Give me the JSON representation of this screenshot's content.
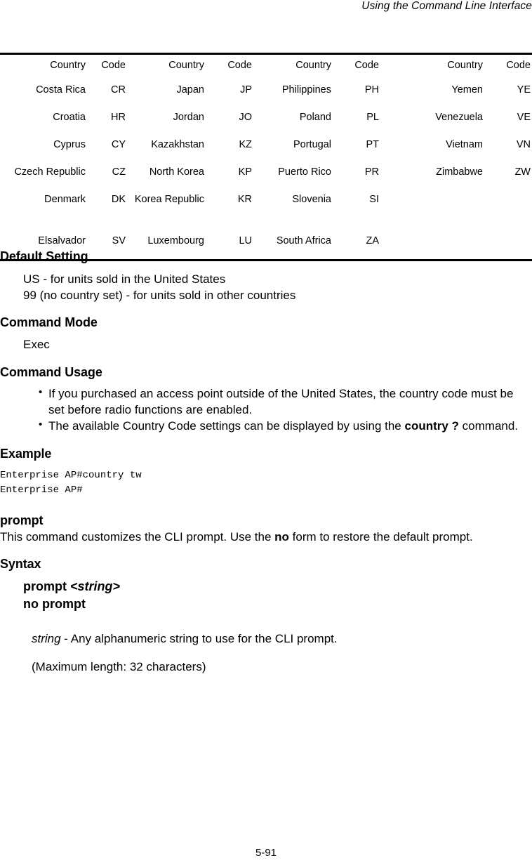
{
  "header": {
    "running_title": "Using the Command Line Interface"
  },
  "country_table": {
    "columns": [
      "Country",
      "Code",
      "Country",
      "Code",
      "Country",
      "Code",
      "Country",
      "Code"
    ],
    "rows": [
      [
        "Costa Rica",
        "CR",
        "Japan",
        "JP",
        "Philippines",
        "PH",
        "Yemen",
        "YE"
      ],
      [
        "Croatia",
        "HR",
        "Jordan",
        "JO",
        "Poland",
        "PL",
        "Venezuela",
        "VE"
      ],
      [
        "Cyprus",
        "CY",
        "Kazakhstan",
        "KZ",
        "Portugal",
        "PT",
        "Vietnam",
        "VN"
      ],
      [
        "Czech Republic",
        "CZ",
        "North Korea",
        "KP",
        "Puerto Rico",
        "PR",
        "Zimbabwe",
        "ZW"
      ],
      [
        "Denmark",
        "DK",
        "Korea Republic",
        "KR",
        "Slovenia",
        "SI",
        "",
        ""
      ],
      [
        "Elsalvador",
        "SV",
        "Luxembourg",
        "LU",
        "South Africa",
        "ZA",
        "",
        ""
      ]
    ]
  },
  "sections": {
    "default_setting": {
      "heading": "Default Setting",
      "line1": "US - for units sold in the United States",
      "line2": "99 (no country set) - for units sold in other countries"
    },
    "command_mode": {
      "heading": "Command Mode",
      "value": "Exec"
    },
    "command_usage": {
      "heading": "Command Usage",
      "bullet1": "If you purchased an access point outside of the United States, the country code must be set before radio functions are enabled.",
      "bullet2_before": "The available Country Code settings can be displayed by using the ",
      "bullet2_bold": "country ?",
      "bullet2_after": " command."
    },
    "example": {
      "heading": "Example",
      "cli_text": "Enterprise AP#country tw\nEnterprise AP#"
    },
    "prompt_command": {
      "heading": "prompt",
      "desc_before": "This command customizes the CLI prompt. Use the ",
      "desc_bold": "no",
      "desc_after": " form to restore the default prompt."
    },
    "syntax": {
      "heading": "Syntax",
      "line1_bold": "prompt",
      "line1_italic": "<string>",
      "line2": "no prompt",
      "arg_italic": "string",
      "arg_rest": " - Any alphanumeric string to use for the CLI prompt.",
      "arg_line2": "(Maximum length: 32 characters)"
    }
  },
  "footer": {
    "page_number": "5-91"
  }
}
